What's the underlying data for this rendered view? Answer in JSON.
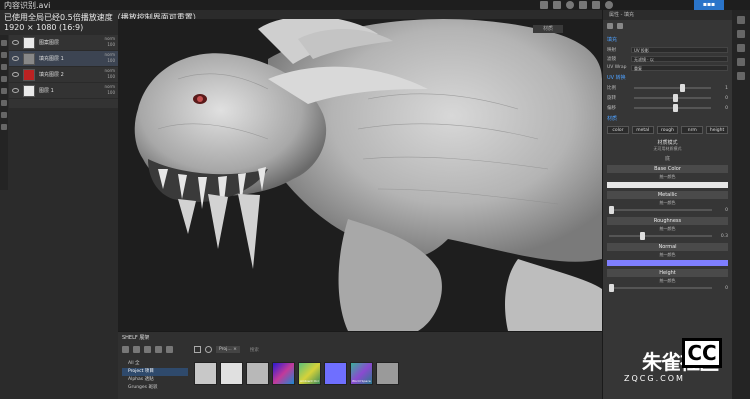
{
  "window": {
    "file_title": "内容识别.avi",
    "notice": "已使用全局已经0.5倍播放速度（播放控制界面可重置）",
    "resolution": "1920 × 1080 (16:9)"
  },
  "layers": [
    {
      "name": "图案图层",
      "mode": "norm\n100",
      "thumb": "white"
    },
    {
      "name": "填充图层 1",
      "mode": "norm\n100",
      "thumb": "dark",
      "active": true
    },
    {
      "name": "填充图层 2",
      "mode": "norm\n100",
      "thumb": "red"
    },
    {
      "name": "图层 1",
      "mode": "norm\n100",
      "thumb": "white"
    }
  ],
  "viewport": {
    "tab_label": "材质"
  },
  "properties": {
    "header": "属性 - 填充",
    "section_fill": "填充",
    "rows": [
      {
        "label": "映射",
        "value": "UV 投影"
      },
      {
        "label": "滤镜",
        "value": "无滤镜 · 以"
      },
      {
        "label": "UV Wrap",
        "value": "重复"
      }
    ],
    "uv_section": "UV 转换",
    "sliders": [
      {
        "label": "比例",
        "value": "1",
        "pos": 0.6
      },
      {
        "label": "旋转",
        "value": "0",
        "pos": 0.5
      },
      {
        "label": "偏移",
        "value": "0",
        "pos": 0.5
      }
    ],
    "material_section": "材质",
    "channels": [
      "color",
      "metal",
      "rough",
      "nrm",
      "height"
    ],
    "material_mode": "材质模式",
    "material_mode_sub": "无可用材质模式",
    "base_section": "底",
    "base_color_title": "Base Color",
    "base_color_sub": "统一颜色",
    "metallic_title": "Metallic",
    "metallic_sub": "统一颜色",
    "metallic_value": "0",
    "roughness_title": "Roughness",
    "roughness_sub": "统一颜色",
    "roughness_value": "0.3",
    "normal_title": "Normal",
    "normal_sub": "统一颜色",
    "height_title": "Height",
    "height_sub": "统一颜色",
    "height_value": "0",
    "colors": {
      "base": "#e6e6e6",
      "normal": "#7f7fff",
      "accent": "#4ea1ff"
    }
  },
  "shelf": {
    "title": "SHELF 展架",
    "items": [
      {
        "label": "All 全"
      },
      {
        "label": "Project 项目",
        "active": true
      },
      {
        "label": "Alphas 透贴"
      },
      {
        "label": "Grunges 斑驳"
      }
    ],
    "filter_chip": "Proj... ×",
    "search_placeholder": "搜索",
    "materials": [
      {
        "color": "#c8c8c8",
        "caption": ""
      },
      {
        "color": "#e0e0e0",
        "caption": ""
      },
      {
        "color": "#b8b8b8",
        "caption": ""
      },
      {
        "color": "#4a2ed0",
        "caption": ""
      },
      {
        "color": "#3aa06a",
        "caption": "Ambient Occ"
      },
      {
        "color": "#6f6fff",
        "caption": ""
      },
      {
        "color": "#2c8f7c",
        "caption": "World Space"
      },
      {
        "color": "#9a9a9a",
        "caption": ""
      }
    ]
  },
  "watermark": {
    "text": "朱雀社区",
    "badge": "CC",
    "url": "ZQCG.COM"
  }
}
